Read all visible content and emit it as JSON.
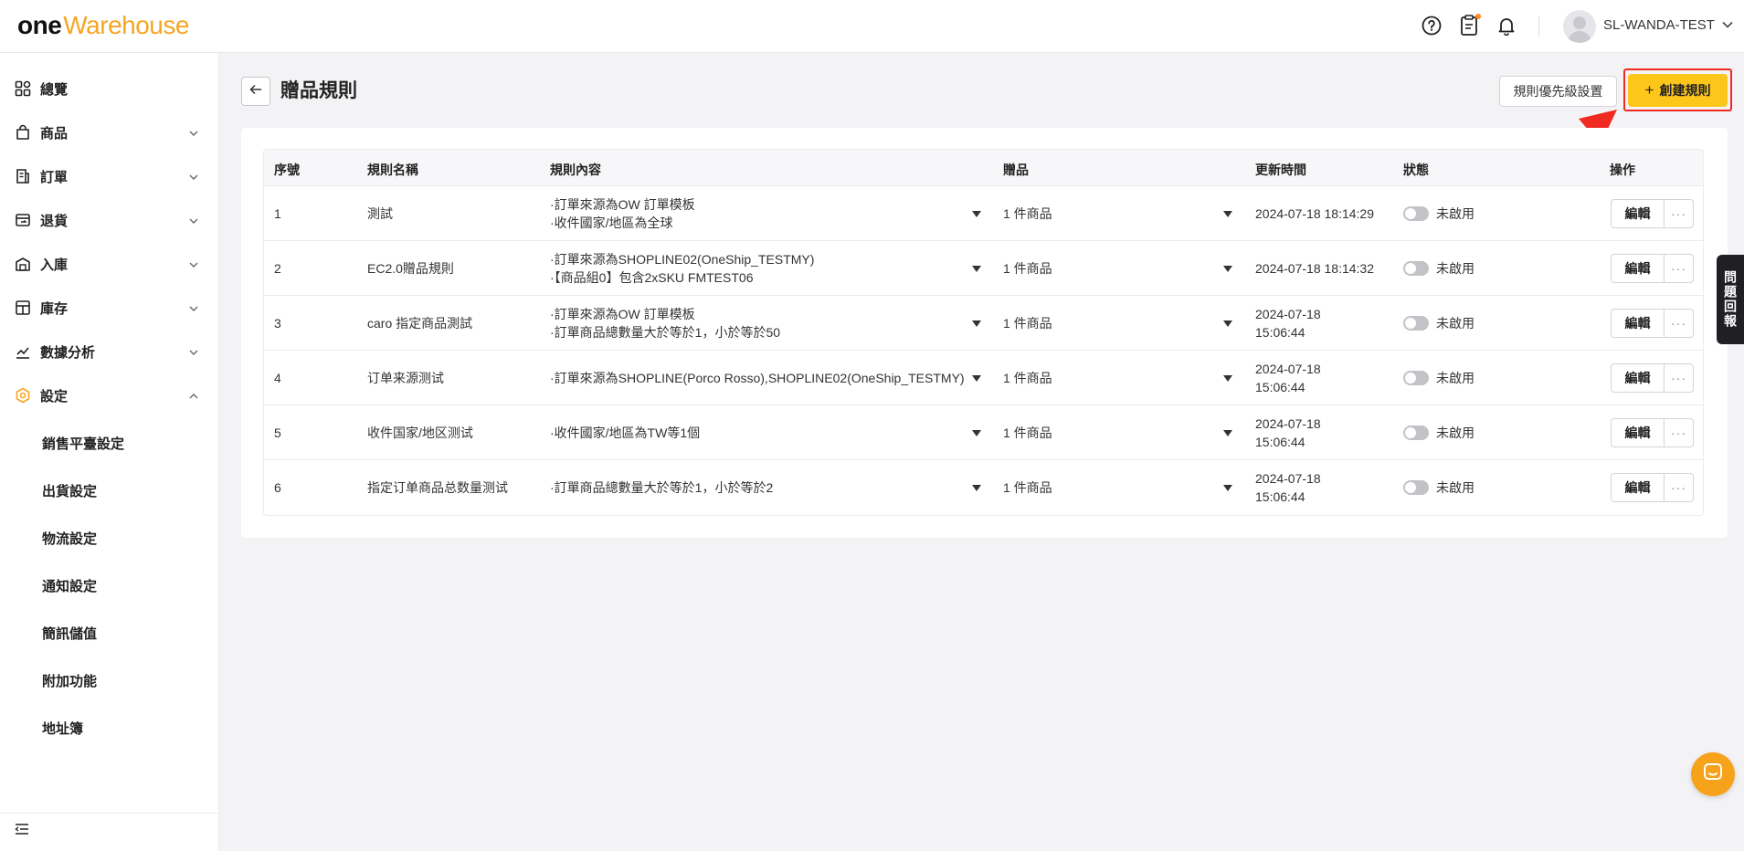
{
  "app": {
    "logo_one": "one",
    "logo_rest": "Warehouse"
  },
  "header": {
    "username": "SL-WANDA-TEST"
  },
  "sidebar": {
    "items": [
      {
        "label": "總覽",
        "icon": "dashboard-icon"
      },
      {
        "label": "商品",
        "icon": "bag-icon"
      },
      {
        "label": "訂單",
        "icon": "order-icon"
      },
      {
        "label": "退貨",
        "icon": "return-icon"
      },
      {
        "label": "入庫",
        "icon": "inbound-icon"
      },
      {
        "label": "庫存",
        "icon": "inventory-icon"
      },
      {
        "label": "數據分析",
        "icon": "analytics-icon"
      },
      {
        "label": "設定",
        "icon": "settings-icon"
      }
    ],
    "sub_items": [
      "銷售平臺設定",
      "出貨設定",
      "物流設定",
      "通知設定",
      "簡訊儲值",
      "附加功能",
      "地址簿"
    ]
  },
  "page": {
    "title": "贈品規則",
    "priority_button": "規則優先級設置",
    "create_button": "創建規則",
    "create_icon": "+"
  },
  "table": {
    "headers": [
      "序號",
      "規則名稱",
      "規則內容",
      "贈品",
      "更新時間",
      "狀態",
      "操作"
    ],
    "rows": [
      {
        "no": "1",
        "name": "測試",
        "rule1": "·訂單來源為OW 訂單模板",
        "rule2": "·收件國家/地區為全球",
        "gift": "1 件商品",
        "time1": "2024-07-18 18:14:29",
        "time2": "",
        "status": "未啟用",
        "edit": "編輯",
        "more": "···"
      },
      {
        "no": "2",
        "name": "EC2.0贈品規則",
        "rule1": "·訂單來源為SHOPLINE02(OneShip_TESTMY)",
        "rule2": "·【商品組0】包含2xSKU FMTEST06",
        "gift": "1 件商品",
        "time1": "2024-07-18 18:14:32",
        "time2": "",
        "status": "未啟用",
        "edit": "編輯",
        "more": "···"
      },
      {
        "no": "3",
        "name": "caro 指定商品測試",
        "rule1": "·訂單來源為OW 訂單模板",
        "rule2": "·訂單商品總數量大於等於1，小於等於50",
        "gift": "1 件商品",
        "time1": "2024-07-18",
        "time2": "15:06:44",
        "status": "未啟用",
        "edit": "編輯",
        "more": "···"
      },
      {
        "no": "4",
        "name": "订单来源测试",
        "rule1": "·訂單來源為SHOPLINE(Porco Rosso),SHOPLINE02(OneShip_TESTMY)",
        "rule2": "",
        "gift": "1 件商品",
        "time1": "2024-07-18",
        "time2": "15:06:44",
        "status": "未啟用",
        "edit": "編輯",
        "more": "···"
      },
      {
        "no": "5",
        "name": "收件国家/地区测试",
        "rule1": "·收件國家/地區為TW等1個",
        "rule2": "",
        "gift": "1 件商品",
        "time1": "2024-07-18",
        "time2": "15:06:44",
        "status": "未啟用",
        "edit": "編輯",
        "more": "···"
      },
      {
        "no": "6",
        "name": "指定订单商品总数量测试",
        "rule1": "·訂單商品總數量大於等於1，小於等於2",
        "rule2": "",
        "gift": "1 件商品",
        "time1": "2024-07-18",
        "time2": "15:06:44",
        "status": "未啟用",
        "edit": "編輯",
        "more": "···"
      }
    ]
  },
  "feedback": {
    "label": "問題回報"
  },
  "colors": {
    "accent": "#fdc61a",
    "brand_orange": "#f5a623",
    "annotation_red": "#f02a20"
  }
}
